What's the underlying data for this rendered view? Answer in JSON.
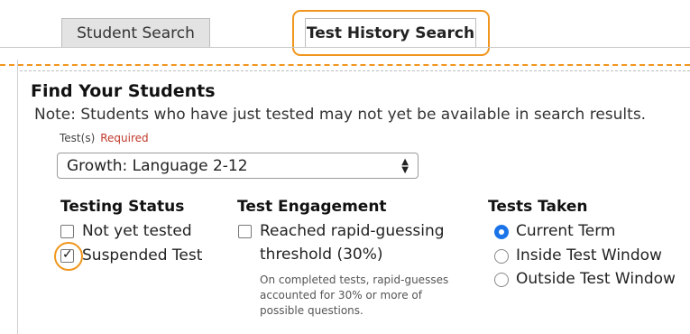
{
  "tabs": [
    {
      "label": "Student Search",
      "active": false
    },
    {
      "label": "Test History Search",
      "active": true
    }
  ],
  "section": {
    "title": "Find Your Students",
    "note": "Note: Students who have just tested may not yet be available in search results."
  },
  "test_select": {
    "label": "Test(s)",
    "required": "Required",
    "value": "Growth: Language 2-12"
  },
  "testing_status": {
    "heading": "Testing Status",
    "options": [
      {
        "label": "Not yet tested",
        "checked": false
      },
      {
        "label": "Suspended Test",
        "checked": true
      }
    ]
  },
  "test_engagement": {
    "heading": "Test Engagement",
    "option_line1": "Reached rapid-guessing",
    "option_line2": "threshold (30%)",
    "checked": false,
    "help_lines": [
      "On completed tests, rapid-guesses",
      "accounted for 30% or more of",
      "possible questions."
    ]
  },
  "tests_taken": {
    "heading": "Tests Taken",
    "options": [
      {
        "label": "Current Term",
        "selected": true
      },
      {
        "label": "Inside Test Window",
        "selected": false
      },
      {
        "label": "Outside Test Window",
        "selected": false
      }
    ]
  },
  "colors": {
    "highlight": "#f0961e",
    "accent": "#1a73e8",
    "required": "#c0392b"
  }
}
